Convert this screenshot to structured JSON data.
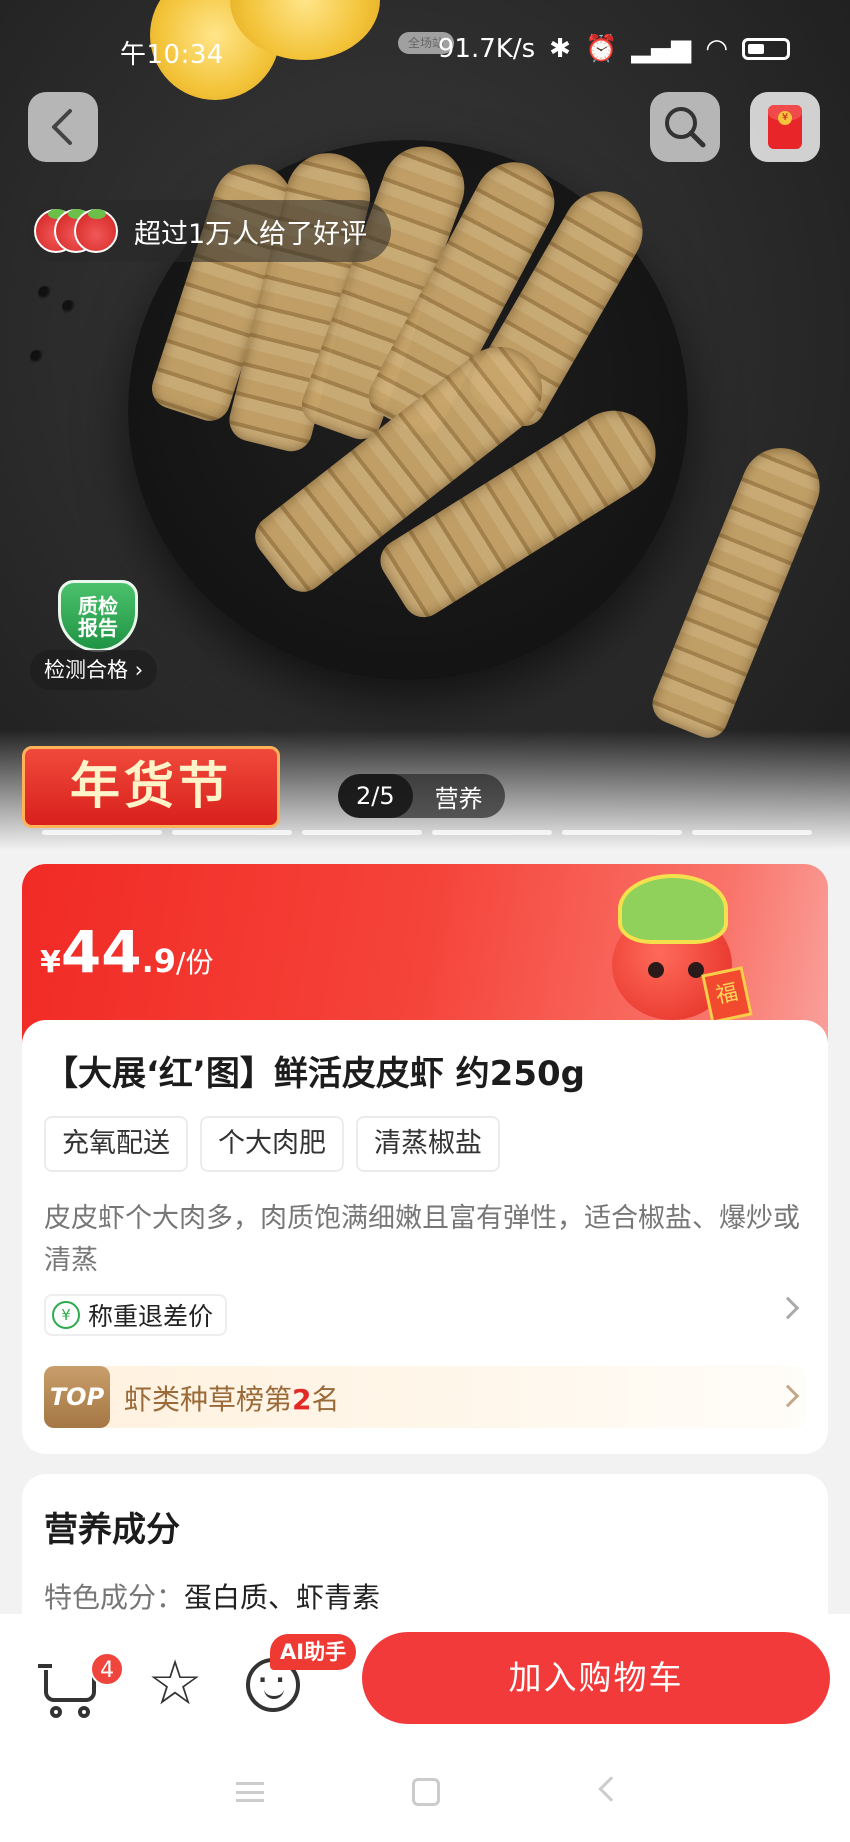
{
  "status_bar": {
    "time": "午10:34",
    "pill": "全场站",
    "speed": "91.7K/s"
  },
  "hero": {
    "review_text": "超过1万人给了好评",
    "qc_badge": "质检\n报告",
    "qc_label": "检测合格",
    "festival_label": "年货节",
    "image_counter": "2/5",
    "image_tab": "营养",
    "image_total": 5
  },
  "price": {
    "currency": "¥",
    "integer": "44",
    "decimal": ".9",
    "unit": "/份",
    "mascot_tag": "福"
  },
  "product": {
    "title": "【大展‘红’图】鲜活皮皮虾 约250g",
    "tags": [
      "充氧配送",
      "个大肉肥",
      "清蒸椒盐"
    ],
    "description": "皮皮虾个大肉多，肉质饱满细嫩且富有弹性，适合椒盐、爆炒或清蒸",
    "refund_icon": "¥",
    "refund_label": "称重退差价",
    "rank_badge": "TOP",
    "rank_prefix": "虾类种草榜第",
    "rank_number": "2",
    "rank_suffix": "名"
  },
  "nutrition": {
    "title": "营养成分",
    "feature_key": "特色成分：",
    "feature_value": "蛋白质、虾青素"
  },
  "bottom_bar": {
    "cart_count": "4",
    "ai_badge": "AI助手",
    "add_to_cart": "加入购物车"
  },
  "icons": [
    "back-icon",
    "search-icon",
    "red-packet-icon",
    "cart-icon",
    "star-icon",
    "ai-assistant-icon"
  ],
  "colors": {
    "accent": "#f33a3a",
    "qc_green": "#1f9444",
    "rank_brown": "#9a6a39"
  }
}
